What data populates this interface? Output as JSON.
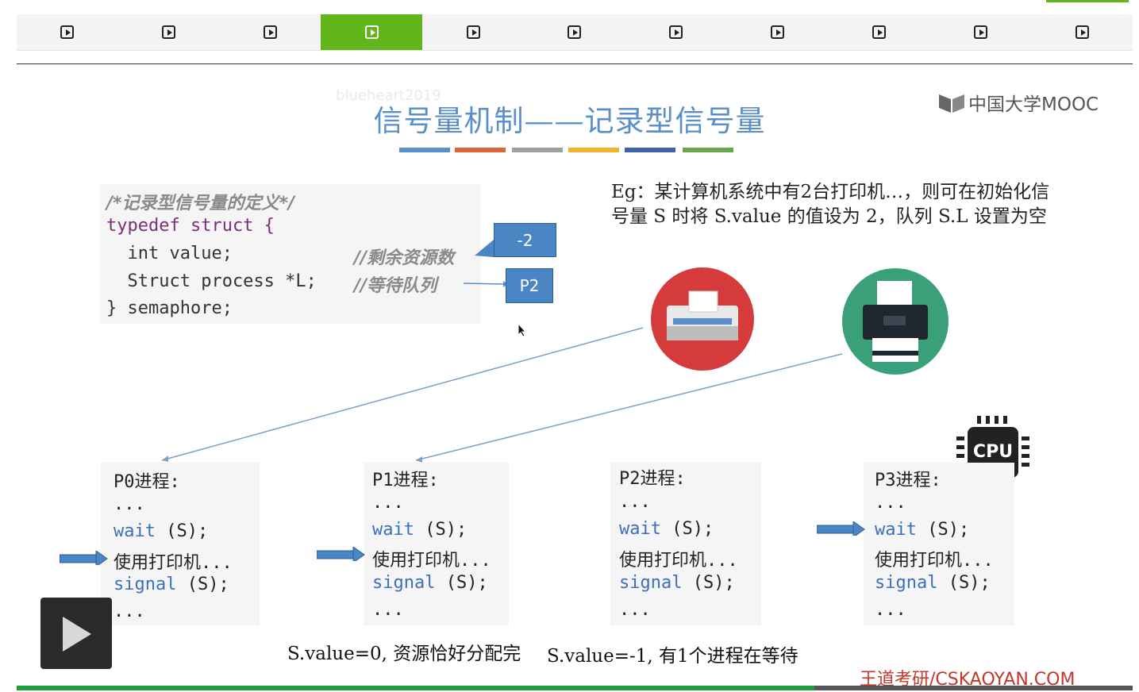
{
  "toolbar": {
    "segments": 11,
    "active_index": 3
  },
  "slide": {
    "watermark": "blueheart2019",
    "title": "信号量机制——记录型信号量",
    "title_bar_colors": [
      "#5b8fc9",
      "#d9693a",
      "#a0a0a0",
      "#f0b62b",
      "#3f62a8",
      "#6aa84f"
    ],
    "logo_text": "中国大学MOOC",
    "code": {
      "comment": "/*记录型信号量的定义*/",
      "line1": "typedef struct {",
      "line2": "  int value;",
      "line2_comment": "//剩余资源数",
      "line3": "  Struct process *L;",
      "line3_comment": "//等待队列",
      "line4": "} semaphore;"
    },
    "value_box": "-2",
    "queue_box": "P2",
    "example_text": "Eg：某计算机系统中有2台打印机…，则可在初始化信号量 S 时将 S.value 的值设为 2，队列 S.L 设置为空",
    "processes": [
      {
        "name": "P0进程:",
        "dots1": "...",
        "wait": "wait",
        "wait_arg": " (S);",
        "use": "使用打印机...",
        "signal": "signal",
        "signal_arg": " (S);",
        "dots2": "..."
      },
      {
        "name": "P1进程:",
        "dots1": "...",
        "wait": "wait",
        "wait_arg": " (S);",
        "use": "使用打印机...",
        "signal": "signal",
        "signal_arg": " (S);",
        "dots2": "..."
      },
      {
        "name": "P2进程:",
        "dots1": "...",
        "wait": "wait",
        "wait_arg": " (S);",
        "use": "使用打印机...",
        "signal": "signal",
        "signal_arg": " (S);",
        "dots2": "..."
      },
      {
        "name": "P3进程:",
        "dots1": "...",
        "wait": "wait",
        "wait_arg": " (S);",
        "use": "使用打印机...",
        "signal": "signal",
        "signal_arg": " (S);",
        "dots2": "..."
      }
    ],
    "cpu_label": "CPU",
    "note_left": "S.value=0, 资源恰好分配完",
    "note_right": "S.value=-1, 有1个进程在等待",
    "site": "王道考研/CSKAOYAN.COM"
  },
  "player": {
    "progress": 0.715
  }
}
